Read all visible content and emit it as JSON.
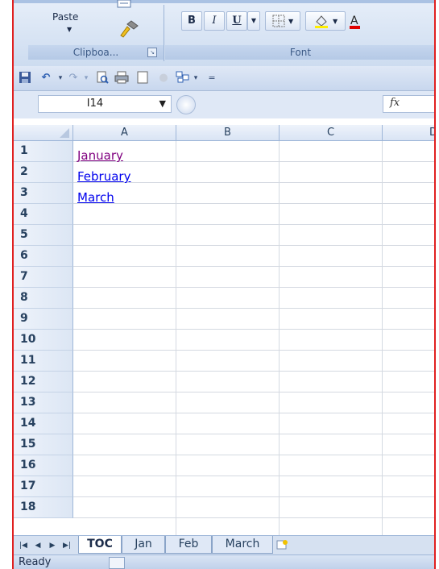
{
  "ribbon": {
    "paste_label": "Paste",
    "clipboard_group": "Clipboa...",
    "font_group": "Font",
    "bold": "B",
    "italic": "I",
    "underline": "U"
  },
  "formula_bar": {
    "name_box": "I14",
    "fx_label": "fx"
  },
  "sheet": {
    "columns": [
      "A",
      "B",
      "C",
      "D"
    ],
    "rows": [
      "1",
      "2",
      "3",
      "4",
      "5",
      "6",
      "7",
      "8",
      "9",
      "10",
      "11",
      "12",
      "13",
      "14",
      "15",
      "16",
      "17",
      "18"
    ],
    "cells": {
      "A1": "January",
      "A2": "February",
      "A3": "March"
    }
  },
  "tabs": [
    "TOC",
    "Jan",
    "Feb",
    "March"
  ],
  "active_tab": "TOC",
  "status": {
    "text": "Ready"
  },
  "colors": {
    "visited_link": "#800080",
    "link": "#0000ee",
    "frame_border": "#e02020"
  }
}
